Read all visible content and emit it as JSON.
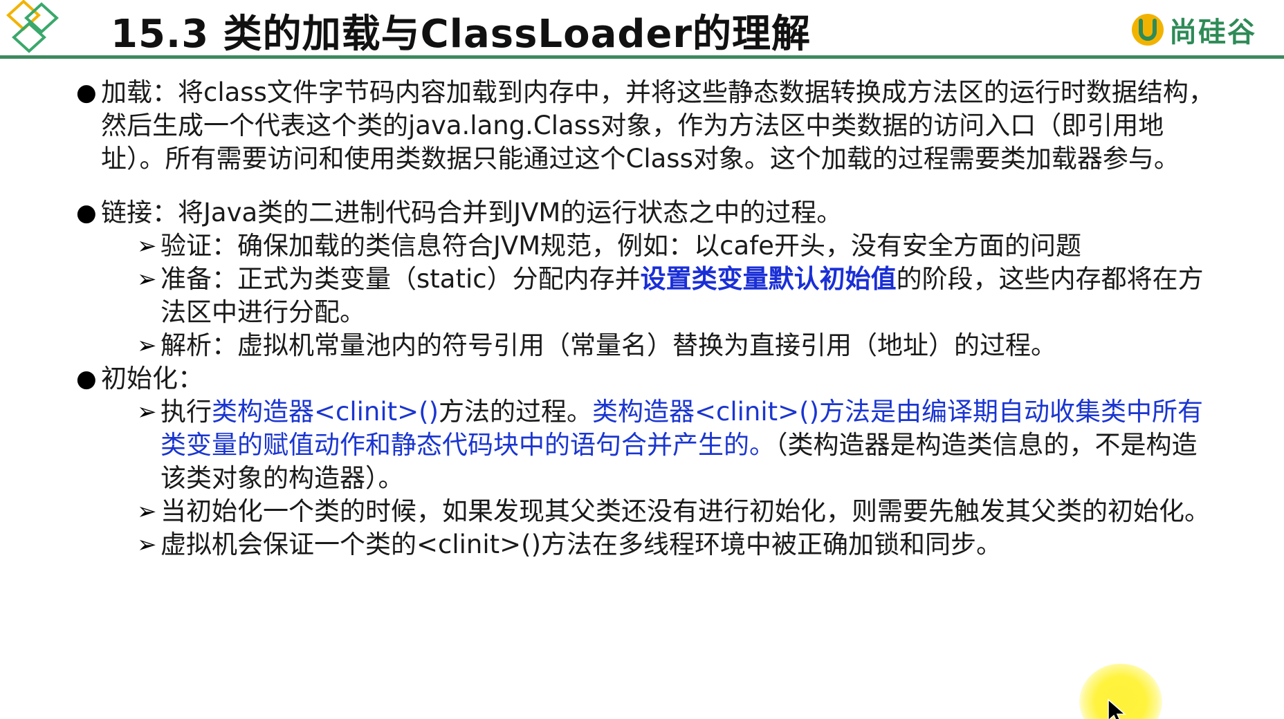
{
  "header": {
    "title": "15.3 类的加载与ClassLoader的理解",
    "brand": "尚硅谷",
    "brand_color": "#2e8b57",
    "rule_color": "#3d8a5e"
  },
  "sections": [
    {
      "label": "加载：",
      "text": "将class文件字节码内容加载到内存中，并将这些静态数据转换成方法区的运行时数据结构，然后生成一个代表这个类的java.lang.Class对象，作为方法区中类数据的访问入口（即引用地址）。所有需要访问和使用类数据只能通过这个Class对象。这个加载的过程需要类加载器参与。"
    },
    {
      "label": "链接：",
      "text": "将Java类的二进制代码合并到JVM的运行状态之中的过程。",
      "subs": [
        {
          "text": "验证：确保加载的类信息符合JVM规范，例如：以cafe开头，没有安全方面的问题"
        },
        {
          "pre": "准备：正式为类变量（static）分配内存并",
          "highlight": "设置类变量默认初始值",
          "post": "的阶段，这些内存都将在方法区中进行分配。"
        },
        {
          "text": "解析：虚拟机常量池内的符号引用（常量名）替换为直接引用（地址）的过程。"
        }
      ]
    },
    {
      "label": "初始化：",
      "text": "",
      "subs": [
        {
          "pre": "执行",
          "highlight1": "类构造器<clinit>()",
          "mid": "方法的过程。",
          "highlight2": "类构造器<clinit>()方法是由编译期自动收集类中所有类变量的赋值动作和静态代码块中的语句合并产生的。",
          "post": "（类构造器是构造类信息的，不是构造该类对象的构造器）。"
        },
        {
          "text": "当初始化一个类的时候，如果发现其父类还没有进行初始化，则需要先触发其父类的初始化。"
        },
        {
          "text": "虚拟机会保证一个类的<clinit>()方法在多线程环境中被正确加锁和同步。"
        }
      ]
    }
  ],
  "colors": {
    "highlight_strong": "#1a2fd6",
    "highlight": "#1a35d0",
    "cursor_glow": "#fff23a"
  }
}
